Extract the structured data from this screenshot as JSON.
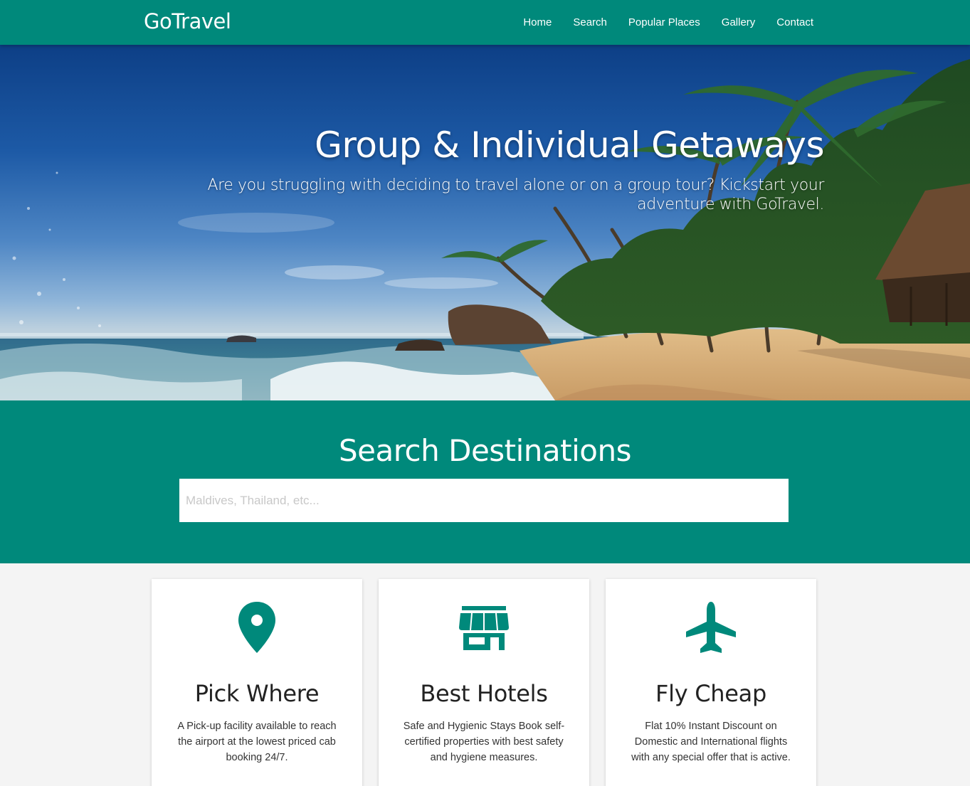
{
  "navbar": {
    "brand": "GoTravel",
    "links": [
      "Home",
      "Search",
      "Popular Places",
      "Gallery",
      "Contact"
    ]
  },
  "hero": {
    "title": "Group & Individual Getaways",
    "subtitle": "Are you struggling with deciding to travel alone or on a group tour? Kickstart your adventure with GoTravel."
  },
  "search": {
    "title": "Search Destinations",
    "placeholder": "Maldives, Thailand, etc..."
  },
  "features": [
    {
      "icon": "map-pin-icon",
      "title": "Pick Where",
      "text": "A Pick-up facility available to reach the airport at the lowest priced cab booking 24/7."
    },
    {
      "icon": "store-icon",
      "title": "Best Hotels",
      "text": "Safe and Hygienic Stays Book self-certified properties with best safety and hygiene measures."
    },
    {
      "icon": "airplane-icon",
      "title": "Fly Cheap",
      "text": "Flat 10% Instant Discount on Domestic and International flights with any special offer that is active."
    }
  ],
  "colors": {
    "primary": "#00897b",
    "background": "#f4f4f4",
    "card": "#ffffff"
  }
}
